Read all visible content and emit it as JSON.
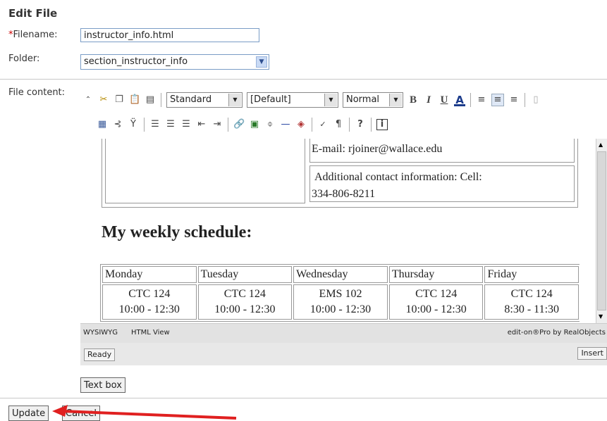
{
  "page": {
    "title": "Edit File"
  },
  "form": {
    "filename_label": "Filename:",
    "filename_required_mark": "*",
    "filename_value": "instructor_info.html",
    "folder_label": "Folder:",
    "folder_value": "section_instructor_info",
    "content_label": "File content:"
  },
  "toolbar": {
    "style_select": "Standard",
    "font_select": "[Default]",
    "size_select": "Normal",
    "bold": "B",
    "italic": "I",
    "underline": "U",
    "font_color": "A",
    "help": "?",
    "info": "i",
    "paragraph": "¶"
  },
  "editor": {
    "email": "E-mail: rjoiner@wallace.edu",
    "additional": "Additional contact information: Cell:",
    "phone": "334-806-8211",
    "heading": "My weekly schedule:",
    "days": [
      "Monday",
      "Tuesday",
      "Wednesday",
      "Thursday",
      "Friday"
    ],
    "rooms": [
      "CTC 124",
      "CTC 124",
      "EMS 102",
      "CTC 124",
      "CTC 124"
    ],
    "times": [
      "10:00 - 12:30",
      "10:00 - 12:30",
      "10:00 - 12:30",
      "10:00 - 12:30",
      "8:30 - 11:30"
    ]
  },
  "status": {
    "tab_wysiwyg": "WYSIWYG",
    "tab_html": "HTML View",
    "brand": "edit-on®Pro by RealObjects",
    "ready": "Ready",
    "insert": "Insert"
  },
  "buttons": {
    "text_box": "Text box",
    "update": "Update",
    "cancel": "Cancel"
  },
  "colors": {
    "arrow": "#e02020",
    "link_border": "#7a9cc6"
  }
}
